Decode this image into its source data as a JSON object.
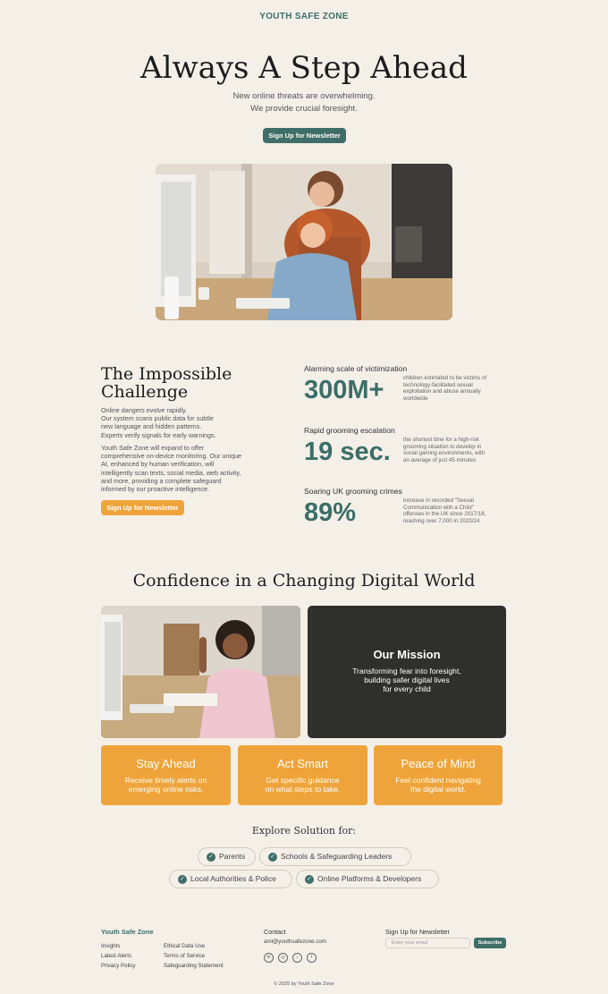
{
  "brand": "YOUTH SAFE ZONE",
  "hero": {
    "title": "Always A Step Ahead",
    "line1": "New online threats are overwhelming.",
    "line2": "We provide crucial foresight.",
    "cta": "Sign Up for Newsletter"
  },
  "challenge": {
    "title_line1": "The Impossible",
    "title_line2": "Challenge",
    "p1": [
      "Online dangers evolve rapidly.",
      "Our system scans public data for subtle",
      "new language and hidden patterns.",
      "Experts verify signals for early warnings."
    ],
    "p2": [
      "Youth Safe Zone will expand to offer",
      "comprehensive on-device monitoring. Our unique",
      "AI, enhanced by human verification, will",
      "intelligently scan texts, social media, web activity,",
      "and more, providing a complete safeguard",
      "informed by our proactive intelligence."
    ],
    "cta": "Sign Up for Newsletter"
  },
  "stats": [
    {
      "heading": "Alarming scale of victimization",
      "value": "300M+",
      "desc": [
        "children estimated to be victims of",
        "technology-facilitated sexual",
        "exploitation and abuse annually",
        "worldwide"
      ]
    },
    {
      "heading": "Rapid grooming escalation",
      "value": "19 sec.",
      "desc": [
        "the shortest time for a high-risk",
        "grooming situation to develop in",
        "social gaming environments, with",
        "an average of just 45 minutes"
      ]
    },
    {
      "heading": "Soaring UK grooming crimes",
      "value": "89%",
      "desc": [
        "increase in recorded \"Sexual",
        "Communication with a Child\"",
        "offenses in the UK since 2017/18,",
        "reaching over 7,000 in 2023/24"
      ]
    }
  ],
  "confidence": {
    "title": "Confidence in a Changing Digital World",
    "mission_title": "Our Mission",
    "mission_lines": [
      "Transforming fear into foresight,",
      "building safer digital lives",
      "for every child"
    ]
  },
  "cards": [
    {
      "title": "Stay Ahead",
      "lines": [
        "Receive timely alerts on",
        "emerging online risks."
      ]
    },
    {
      "title": "Act Smart",
      "lines": [
        "Get specific guidance",
        "on what steps to take."
      ]
    },
    {
      "title": "Peace of Mind",
      "lines": [
        "Feel confident navigating",
        "the digital world."
      ]
    }
  ],
  "explore": {
    "title": "Explore Solution for:",
    "pills": [
      "Parents",
      "Schools & Safeguarding Leaders",
      "Local Authorities & Police",
      "Online Platforms & Developers"
    ]
  },
  "footer": {
    "brand": "Youth Safe Zone",
    "links_col1": [
      "Insights",
      "Latest Alerts",
      "Privacy Policy"
    ],
    "links_col2": [
      "Ethical Data Use",
      "Terms of Service",
      "Safeguarding Statement"
    ],
    "contact_heading": "Contact",
    "email": "aml@youthsafezone.com",
    "social": [
      "linkedin-icon",
      "instagram-icon",
      "tiktok-icon",
      "facebook-icon"
    ],
    "newsletter_heading": "Sign Up for Newsletter",
    "email_placeholder": "Enter your email",
    "subscribe": "Subscribe",
    "copyright": "© 2025 by Youth Safe Zone"
  },
  "colors": {
    "teal": "#3f6e68",
    "orange": "#eea43a",
    "background": "#f4efe7",
    "dark": "#2f2f2c"
  }
}
